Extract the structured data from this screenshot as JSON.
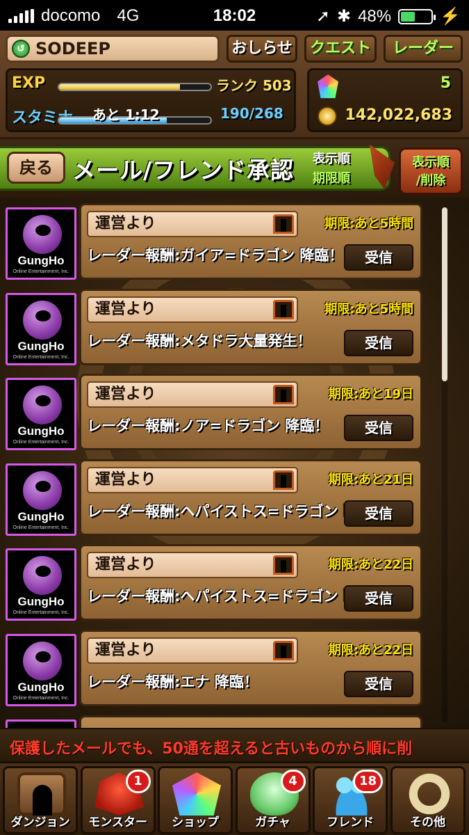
{
  "status_bar": {
    "carrier": "docomo",
    "network": "4G",
    "time": "18:02",
    "battery": "48%",
    "battery_level": 0.48
  },
  "header": {
    "player_name": "SODEEP",
    "news_button": "おしらせ",
    "quest_button": "クエスト",
    "radar_button": "レーダー",
    "exp_label": "EXP",
    "exp_progress": 0.8,
    "rank": "ランク 503",
    "stamina_label": "スタミナ",
    "stamina_timer": "あと 1:12",
    "stamina_value": "190/268",
    "stamina_progress": 0.71,
    "magic_stones": "5",
    "coins": "142,022,683"
  },
  "title_bar": {
    "back_button": "戻る",
    "title": "メール/フレンド承認",
    "sort_line1": "表示順",
    "sort_line2": "期限順",
    "sort_delete_button": "表示順\n/削除"
  },
  "mails": [
    {
      "logo": "GungHo",
      "logo_sub": "Online Entertainment, Inc.",
      "sender": "運営より",
      "deadline": "期限:あと5時間",
      "subject": "レーダー報酬:ガイア=ドラゴン 降臨！",
      "action": "受信"
    },
    {
      "logo": "GungHo",
      "logo_sub": "Online Entertainment, Inc.",
      "sender": "運営より",
      "deadline": "期限:あと5時間",
      "subject": "レーダー報酬:メタドラ大量発生！",
      "action": "受信"
    },
    {
      "logo": "GungHo",
      "logo_sub": "Online Entertainment, Inc.",
      "sender": "運営より",
      "deadline": "期限:あと19日",
      "subject": "レーダー報酬:ノア=ドラゴン 降臨！",
      "action": "受信"
    },
    {
      "logo": "GungHo",
      "logo_sub": "Online Entertainment, Inc.",
      "sender": "運営より",
      "deadline": "期限:あと21日",
      "subject": "レーダー報酬:ヘパイストス=ドラゴン 降臨！",
      "action": "受信"
    },
    {
      "logo": "GungHo",
      "logo_sub": "Online Entertainment, Inc.",
      "sender": "運営より",
      "deadline": "期限:あと22日",
      "subject": "レーダー報酬:ヘパイストス=ドラゴン 降臨！",
      "action": "受信"
    },
    {
      "logo": "GungHo",
      "logo_sub": "Online Entertainment, Inc.",
      "sender": "運営より",
      "deadline": "期限:あと22日",
      "subject": "レーダー報酬:エナ 降臨！",
      "action": "受信"
    }
  ],
  "notice": "保護したメールでも、50通を超えると古いものから順に削",
  "bottom_nav": [
    {
      "label": "ダンジョン",
      "icon": "dungeon-icon",
      "badge": ""
    },
    {
      "label": "モンスター",
      "icon": "monster-icon",
      "badge": "1"
    },
    {
      "label": "ショップ",
      "icon": "shop-icon",
      "badge": ""
    },
    {
      "label": "ガチャ",
      "icon": "gacha-icon",
      "badge": "4"
    },
    {
      "label": "フレンド",
      "icon": "friend-icon",
      "badge": "18"
    },
    {
      "label": "その他",
      "icon": "other-icon",
      "badge": ""
    }
  ],
  "colors": {
    "accent_green": "#b8ff5c",
    "deadline_yellow": "#ffe400",
    "notice_red": "#ff3a2a",
    "logo_border": "#d858e8"
  }
}
